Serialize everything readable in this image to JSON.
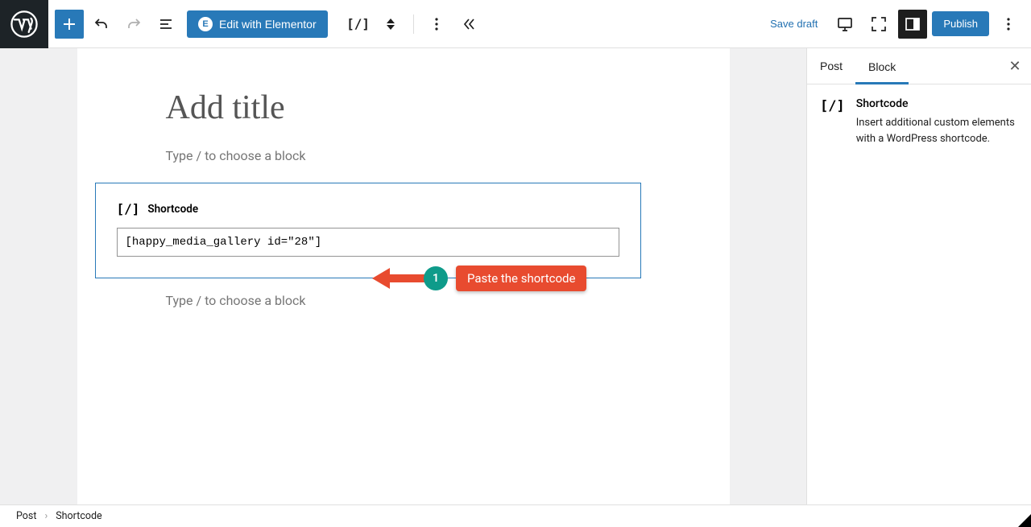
{
  "topbar": {
    "elementor_label": "Edit with Elementor",
    "save_draft": "Save draft",
    "publish": "Publish"
  },
  "editor": {
    "title_placeholder": "Add title",
    "block_hint": "Type / to choose a block"
  },
  "shortcode_block": {
    "label": "Shortcode",
    "value": "[happy_media_gallery id=\"28\"]"
  },
  "annotation": {
    "step_number": "1",
    "text": "Paste the shortcode"
  },
  "sidebar": {
    "tabs": {
      "post": "Post",
      "block": "Block"
    },
    "panel": {
      "title": "Shortcode",
      "description": "Insert additional custom elements with a WordPress shortcode."
    }
  },
  "breadcrumb": {
    "root": "Post",
    "current": "Shortcode"
  }
}
